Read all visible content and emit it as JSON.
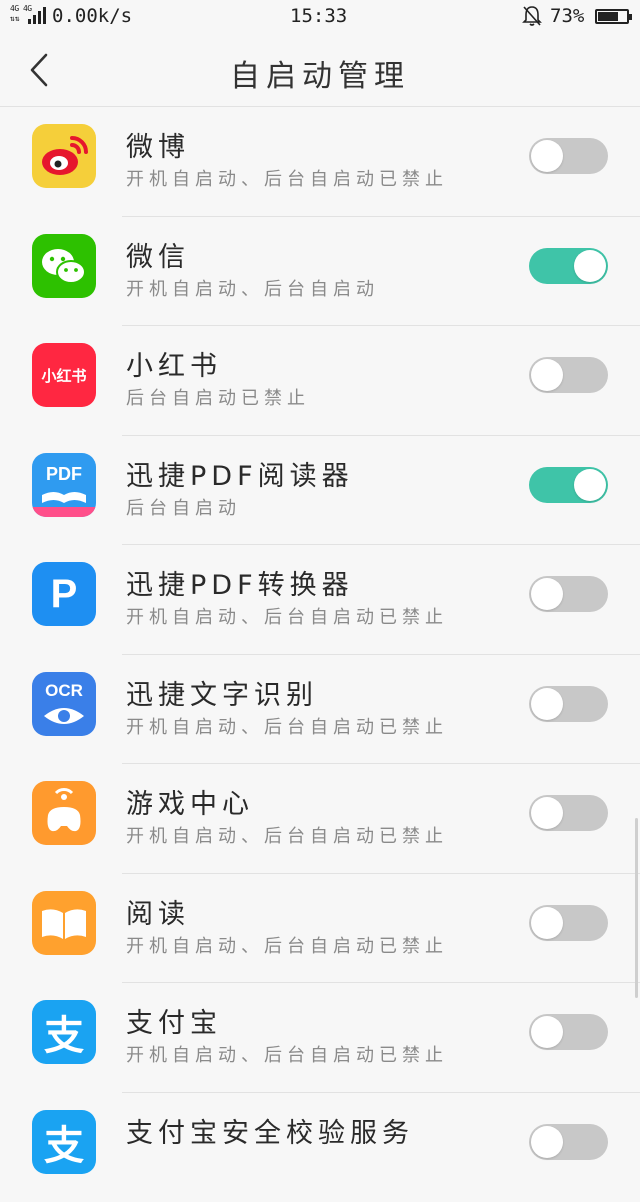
{
  "status_bar": {
    "network": "4G 4G",
    "speed": "0.00k/s",
    "time": "15:33",
    "battery_percent": "73%",
    "battery_level": 0.73
  },
  "header": {
    "title": "自启动管理",
    "back_icon": "chevron-left-icon"
  },
  "apps": [
    {
      "name": "微博",
      "status": "开机自启动、后台自启动已禁止",
      "enabled": false,
      "icon": "weibo-icon",
      "icon_bg": "#f5cf3a"
    },
    {
      "name": "微信",
      "status": "开机自启动、后台自启动",
      "enabled": true,
      "icon": "wechat-icon",
      "icon_bg": "#2dc100"
    },
    {
      "name": "小红书",
      "status": "后台自启动已禁止",
      "enabled": false,
      "icon": "xiaohongshu-icon",
      "icon_bg": "#ff2741",
      "icon_text": "小红书"
    },
    {
      "name": "迅捷PDF阅读器",
      "status": "后台自启动",
      "enabled": true,
      "icon": "pdf-reader-icon",
      "icon_bg": "#2f9bf0",
      "icon_text": "PDF"
    },
    {
      "name": "迅捷PDF转换器",
      "status": "开机自启动、后台自启动已禁止",
      "enabled": false,
      "icon": "pdf-converter-icon",
      "icon_bg": "#1e8ff2",
      "icon_text": "P"
    },
    {
      "name": "迅捷文字识别",
      "status": "开机自启动、后台自启动已禁止",
      "enabled": false,
      "icon": "ocr-icon",
      "icon_bg": "#3a7fe8",
      "icon_text": "OCR"
    },
    {
      "name": "游戏中心",
      "status": "开机自启动、后台自启动已禁止",
      "enabled": false,
      "icon": "game-center-icon",
      "icon_bg": "#ff9a2e"
    },
    {
      "name": "阅读",
      "status": "开机自启动、后台自启动已禁止",
      "enabled": false,
      "icon": "reading-icon",
      "icon_bg": "#ffa12e"
    },
    {
      "name": "支付宝",
      "status": "开机自启动、后台自启动已禁止",
      "enabled": false,
      "icon": "alipay-icon",
      "icon_bg": "#1aa3f2",
      "icon_text": "支"
    },
    {
      "name": "支付宝安全校验服务",
      "status": "",
      "enabled": false,
      "icon": "alipay-security-icon",
      "icon_bg": "#1aa3f2",
      "icon_text": "支"
    }
  ],
  "colors": {
    "toggle_on": "#3fc4a8",
    "toggle_off": "#c8c8c8"
  }
}
